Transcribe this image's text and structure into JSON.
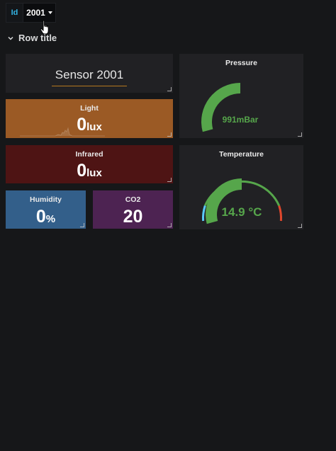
{
  "variable": {
    "label": "Id",
    "value": "2001"
  },
  "row": {
    "title": "Row title"
  },
  "panels": {
    "sensor": {
      "text": "Sensor 2001"
    },
    "light": {
      "title": "Light",
      "value": "0",
      "unit": "lux",
      "color": "#9b5a25"
    },
    "infrared": {
      "title": "Infrared",
      "value": "0",
      "unit": "lux",
      "color": "#4e1414"
    },
    "humidity": {
      "title": "Humidity",
      "value": "0",
      "unit": "%",
      "color": "#335f8a"
    },
    "co2": {
      "title": "CO2",
      "value": "20",
      "unit": "",
      "color": "#4d2352"
    },
    "pressure": {
      "title": "Pressure",
      "value_text": "991mBar",
      "color": "#56a64b",
      "fill": 0.5
    },
    "temperature": {
      "title": "Temperature",
      "value_text": "14.9 °C",
      "color": "#56a64b",
      "fill": 0.5
    }
  },
  "colors": {
    "background": "#161719",
    "panel": "#212124",
    "accent": "#33b5e5"
  },
  "icons": {
    "row_toggle": "chevron-down-icon",
    "variable_caret": "caret-down-icon",
    "cursor": "hand-pointer-icon",
    "resize": "resize-handle-icon"
  }
}
